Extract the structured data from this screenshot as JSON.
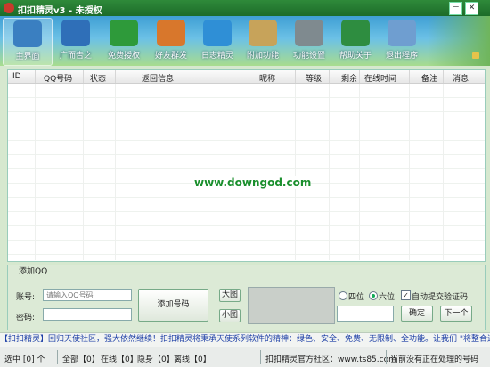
{
  "titlebar": {
    "title": "扣扣精灵v3 - 未授权",
    "btn_min": "－",
    "btn_close": "✕"
  },
  "toolbar": [
    {
      "label": "主界面",
      "icon": "monitor-icon",
      "color": "#3a7fc1"
    },
    {
      "label": "广而告之",
      "icon": "lightning-icon",
      "color": "#2f6fb8"
    },
    {
      "label": "免费授权",
      "icon": "shield-icon",
      "color": "#2e9a3a"
    },
    {
      "label": "好友群发",
      "icon": "windows-icon",
      "color": "#d8772c"
    },
    {
      "label": "日志精灵",
      "icon": "shield-check-icon",
      "color": "#2f8fd6"
    },
    {
      "label": "附加功能",
      "icon": "briefcase-icon",
      "color": "#c7a35a"
    },
    {
      "label": "功能设置",
      "icon": "settings-icon",
      "color": "#7f8a8f"
    },
    {
      "label": "帮助关于",
      "icon": "help-monitor-icon",
      "color": "#2e8d40"
    },
    {
      "label": "退出程序",
      "icon": "exit-disc-icon",
      "color": "#6f9ed0"
    }
  ],
  "grid": {
    "columns": [
      "ID",
      "QQ号码",
      "状态",
      "返回信息",
      "昵称",
      "等级",
      "剩余",
      "在线时间",
      "备注",
      "消息"
    ]
  },
  "watermark": "www.downgod.com",
  "panel": {
    "legend": "添加QQ",
    "account_label": "账号:",
    "account_placeholder": "请输入QQ号码",
    "password_label": "密码:",
    "add_button": "添加号码",
    "big_image": "大图",
    "small_image": "小图",
    "radio_4": "四位",
    "radio_6": "六位",
    "auto_submit": "自动提交验证码",
    "confirm": "确定",
    "next": "下一个"
  },
  "marquee": "【扣扣精灵】回归天使社区，强大依然继续！扣扣精灵将秉承天使系列软件的精神：绿色、安全、免费、无限制、全功能。让我们 \"将整合进行到底\"",
  "status": {
    "selected": "选中 [0] 个",
    "all": "全部【0】",
    "online": "在线【0】",
    "hidden": "隐身【0】",
    "offline": "离线【0】",
    "community": "扣扣精灵官方社区：www.ts85.com",
    "current": "当前没有正在处理的号码"
  }
}
